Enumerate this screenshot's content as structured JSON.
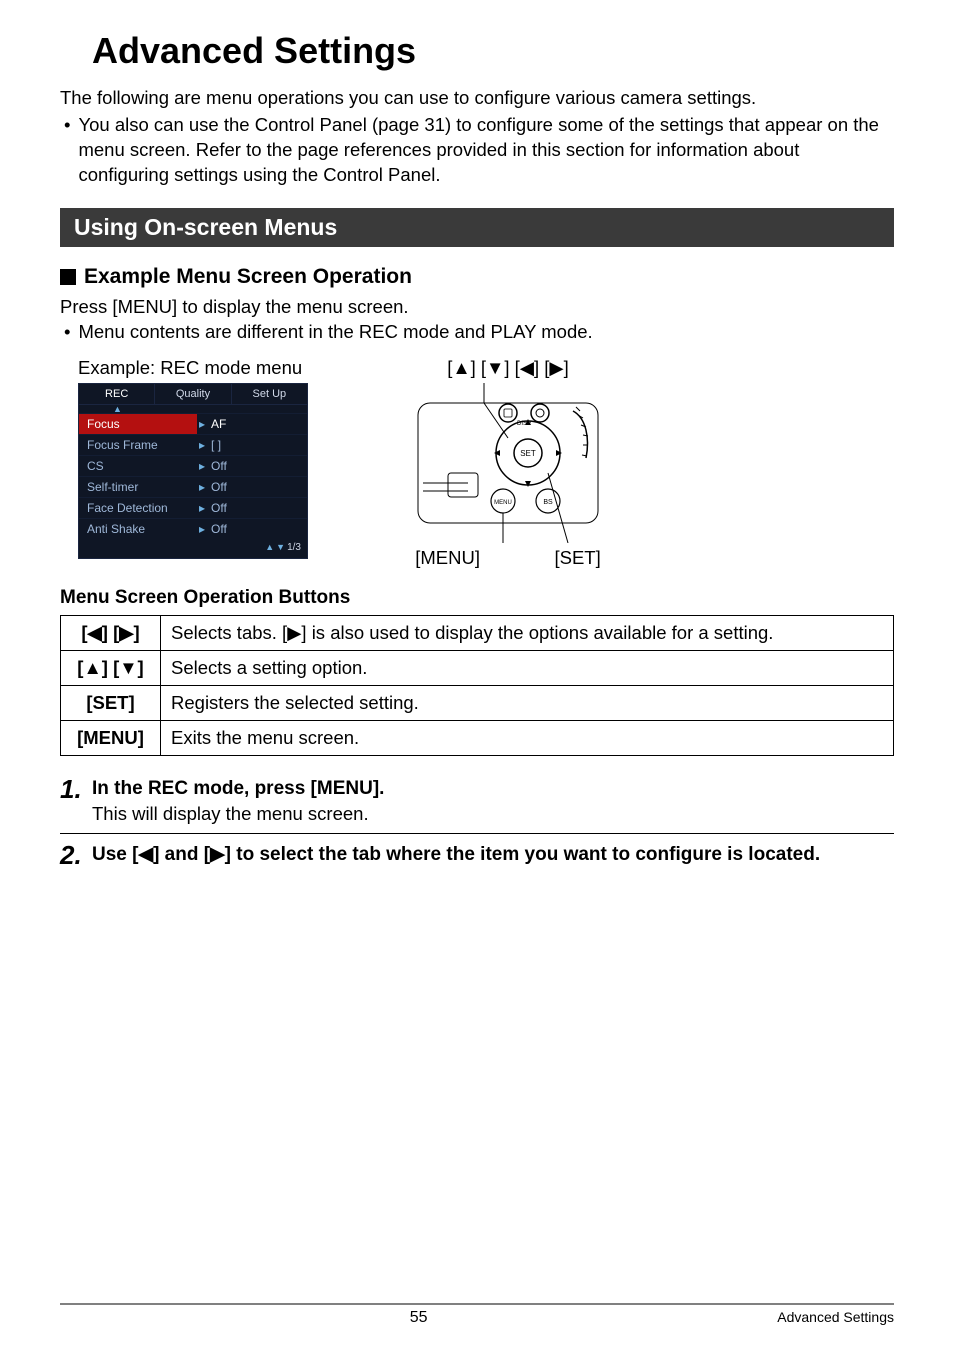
{
  "title": "Advanced Settings",
  "intro": "The following are menu operations you can use to configure various camera settings.",
  "intro_bullet": "You also can use the Control Panel (page 31) to configure some of the settings that appear on the menu screen. Refer to the page references provided in this section for information about configuring settings using the Control Panel.",
  "section_heading": "Using On-screen Menus",
  "sub_heading": "Example Menu Screen Operation",
  "press_text": "Press [MENU] to display the menu screen.",
  "press_bullet": "Menu contents are different in the REC mode and PLAY mode.",
  "example_caption": "Example: REC mode menu",
  "controller_caption": "[▲] [▼] [◀] [▶]",
  "controller_left_label": "[MENU]",
  "controller_right_label": "[SET]",
  "rec_menu": {
    "tabs": [
      "REC",
      "Quality",
      "Set Up"
    ],
    "items": [
      {
        "label": "Focus",
        "value": "AF",
        "active": true
      },
      {
        "label": "Focus Frame",
        "value": "[ ]"
      },
      {
        "label": "CS",
        "value": "Off"
      },
      {
        "label": "Self-timer",
        "value": "Off"
      },
      {
        "label": "Face Detection",
        "value": "Off"
      },
      {
        "label": "Anti Shake",
        "value": "Off"
      }
    ],
    "pager": "1/3"
  },
  "ops_heading": "Menu Screen Operation Buttons",
  "ops_table": [
    {
      "btn": "[◀] [▶]",
      "desc": "Selects tabs. [▶] is also used to display the options available for a setting."
    },
    {
      "btn": "[▲] [▼]",
      "desc": "Selects a setting option."
    },
    {
      "btn": "[SET]",
      "desc": "Registers the selected setting."
    },
    {
      "btn": "[MENU]",
      "desc": "Exits the menu screen."
    }
  ],
  "steps": [
    {
      "num": "1.",
      "title": "In the REC mode, press [MENU].",
      "body": "This will display the menu screen."
    },
    {
      "num": "2.",
      "title": "Use [◀] and [▶] to select the tab where the item you want to configure is located.",
      "body": ""
    }
  ],
  "footer": {
    "page": "55",
    "section": "Advanced Settings"
  }
}
